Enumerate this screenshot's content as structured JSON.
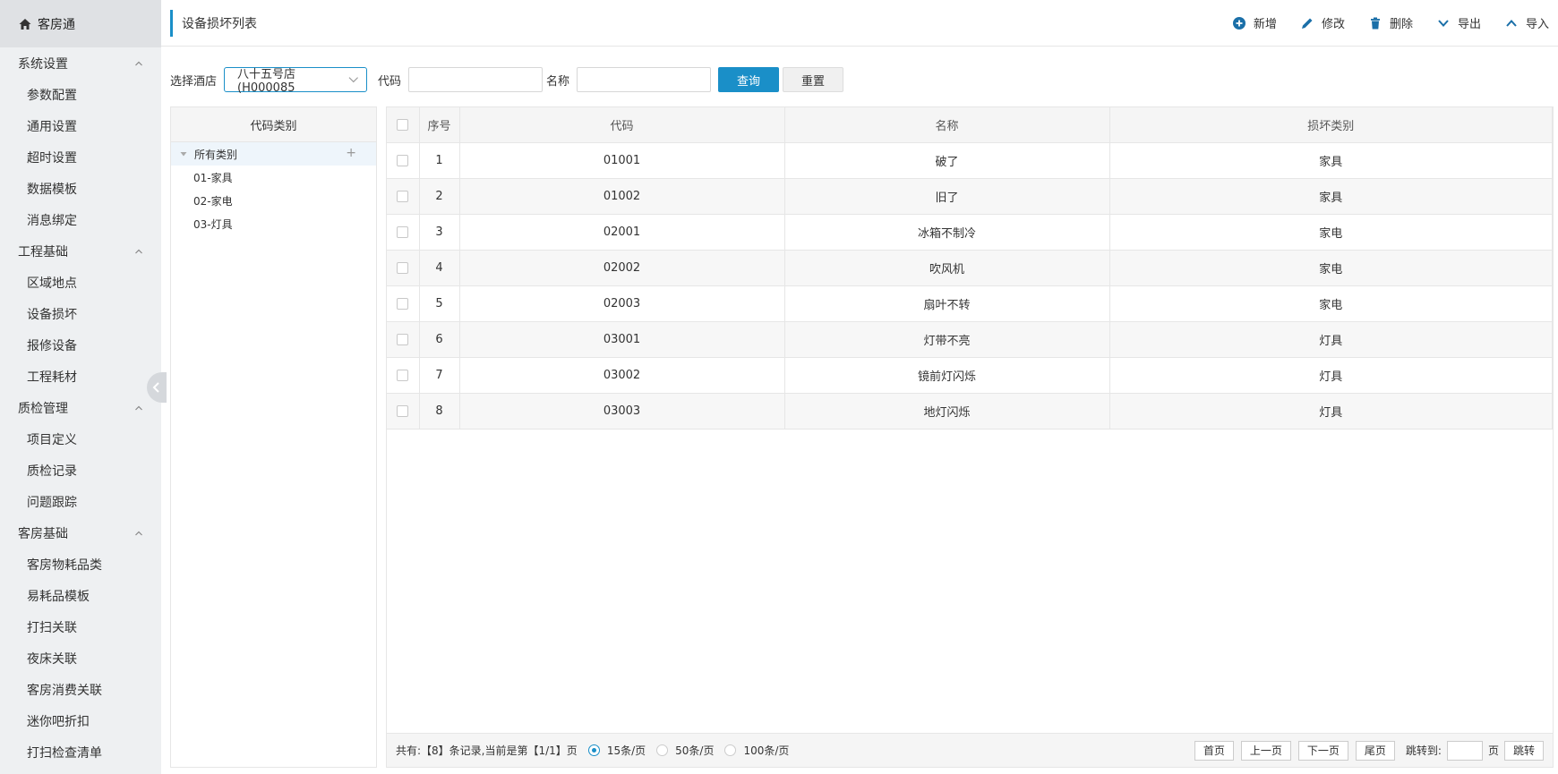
{
  "app": {
    "title": "客房通"
  },
  "sidebar": {
    "groups": [
      {
        "label": "系统设置",
        "items": [
          "参数配置",
          "通用设置",
          "超时设置",
          "数据模板",
          "消息绑定"
        ]
      },
      {
        "label": "工程基础",
        "items": [
          "区域地点",
          "设备损坏",
          "报修设备",
          "工程耗材"
        ]
      },
      {
        "label": "质检管理",
        "items": [
          "项目定义",
          "质检记录",
          "问题跟踪"
        ]
      },
      {
        "label": "客房基础",
        "items": [
          "客房物耗品类",
          "易耗品模板",
          "打扫关联",
          "夜床关联",
          "客房消费关联",
          "迷你吧折扣",
          "打扫检查清单"
        ]
      }
    ]
  },
  "header": {
    "title": "设备损坏列表"
  },
  "toolbar": {
    "add": "新增",
    "edit": "修改",
    "delete": "删除",
    "export": "导出",
    "import": "导入"
  },
  "filter": {
    "hotel_label": "选择酒店",
    "hotel_value": "八十五号店(H000085",
    "code_label": "代码",
    "code_value": "",
    "name_label": "名称",
    "name_value": "",
    "query": "查询",
    "reset": "重置"
  },
  "tree": {
    "header": "代码类别",
    "root": "所有类别",
    "children": [
      "01-家具",
      "02-家电",
      "03-灯具"
    ]
  },
  "table": {
    "columns": [
      "序号",
      "代码",
      "名称",
      "损坏类别"
    ],
    "rows": [
      {
        "no": "1",
        "code": "01001",
        "name": "破了",
        "category": "家具"
      },
      {
        "no": "2",
        "code": "01002",
        "name": "旧了",
        "category": "家具"
      },
      {
        "no": "3",
        "code": "02001",
        "name": "冰箱不制冷",
        "category": "家电"
      },
      {
        "no": "4",
        "code": "02002",
        "name": "吹风机",
        "category": "家电"
      },
      {
        "no": "5",
        "code": "02003",
        "name": "扇叶不转",
        "category": "家电"
      },
      {
        "no": "6",
        "code": "03001",
        "name": "灯带不亮",
        "category": "灯具"
      },
      {
        "no": "7",
        "code": "03002",
        "name": "镜前灯闪烁",
        "category": "灯具"
      },
      {
        "no": "8",
        "code": "03003",
        "name": "地灯闪烁",
        "category": "灯具"
      }
    ]
  },
  "pager": {
    "summary": "共有:【8】条记录,当前是第【1/1】页",
    "sizes": [
      "15条/页",
      "50条/页",
      "100条/页"
    ],
    "selected_size": "15条/页",
    "first": "首页",
    "prev": "上一页",
    "next": "下一页",
    "last": "尾页",
    "jump_label": "跳转到:",
    "page_unit": "页",
    "jump_btn": "跳转"
  },
  "colors": {
    "accent": "#1a8fc8",
    "sidebar_bg": "#eef0f2"
  },
  "icons": {
    "brand": "home-icon",
    "group": "chevron-up-icon",
    "collapse": "chevron-left-icon",
    "add": "plus-circle-icon",
    "edit": "pencil-icon",
    "delete": "trash-icon",
    "export": "chevron-down-icon",
    "import": "chevron-up-icon",
    "select": "chevron-down-icon",
    "tree_root": "triangle-down-icon",
    "tree_add": "plus-icon"
  }
}
